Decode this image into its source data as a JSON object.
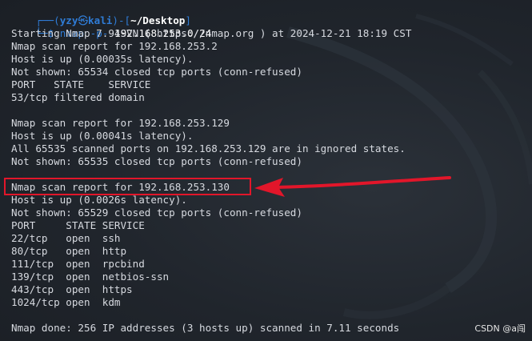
{
  "prompt": {
    "frame_left": "┌──(",
    "user": "yzy",
    "skull": "㉿",
    "host": "kali",
    "frame_mid": ")-[",
    "path": "~/Desktop",
    "frame_right": "]",
    "line2_prefix": "└─",
    "dollar": "$",
    "command": "nmap",
    "flag": "-p-",
    "target": "192.168.253.0/24"
  },
  "output": [
    "Starting Nmap 7.94SVN ( https://nmap.org ) at 2024-12-21 18:19 CST",
    "Nmap scan report for 192.168.253.2",
    "Host is up (0.00035s latency).",
    "Not shown: 65534 closed tcp ports (conn-refused)",
    "PORT   STATE    SERVICE",
    "53/tcp filtered domain",
    "",
    "Nmap scan report for 192.168.253.129",
    "Host is up (0.00041s latency).",
    "All 65535 scanned ports on 192.168.253.129 are in ignored states.",
    "Not shown: 65535 closed tcp ports (conn-refused)",
    "",
    "Nmap scan report for 192.168.253.130",
    "Host is up (0.0026s latency).",
    "Not shown: 65529 closed tcp ports (conn-refused)",
    "PORT     STATE SERVICE",
    "22/tcp   open  ssh",
    "80/tcp   open  http",
    "111/tcp  open  rpcbind",
    "139/tcp  open  netbios-ssn",
    "443/tcp  open  https",
    "1024/tcp open  kdm",
    "",
    "Nmap done: 256 IP addresses (3 hosts up) scanned in 7.11 seconds"
  ],
  "watermark": "CSDN @a闯",
  "colors": {
    "prompt": "#2f7cd6",
    "highlight": "#e2162a",
    "text": "#d7dae0",
    "background": "#232830"
  }
}
